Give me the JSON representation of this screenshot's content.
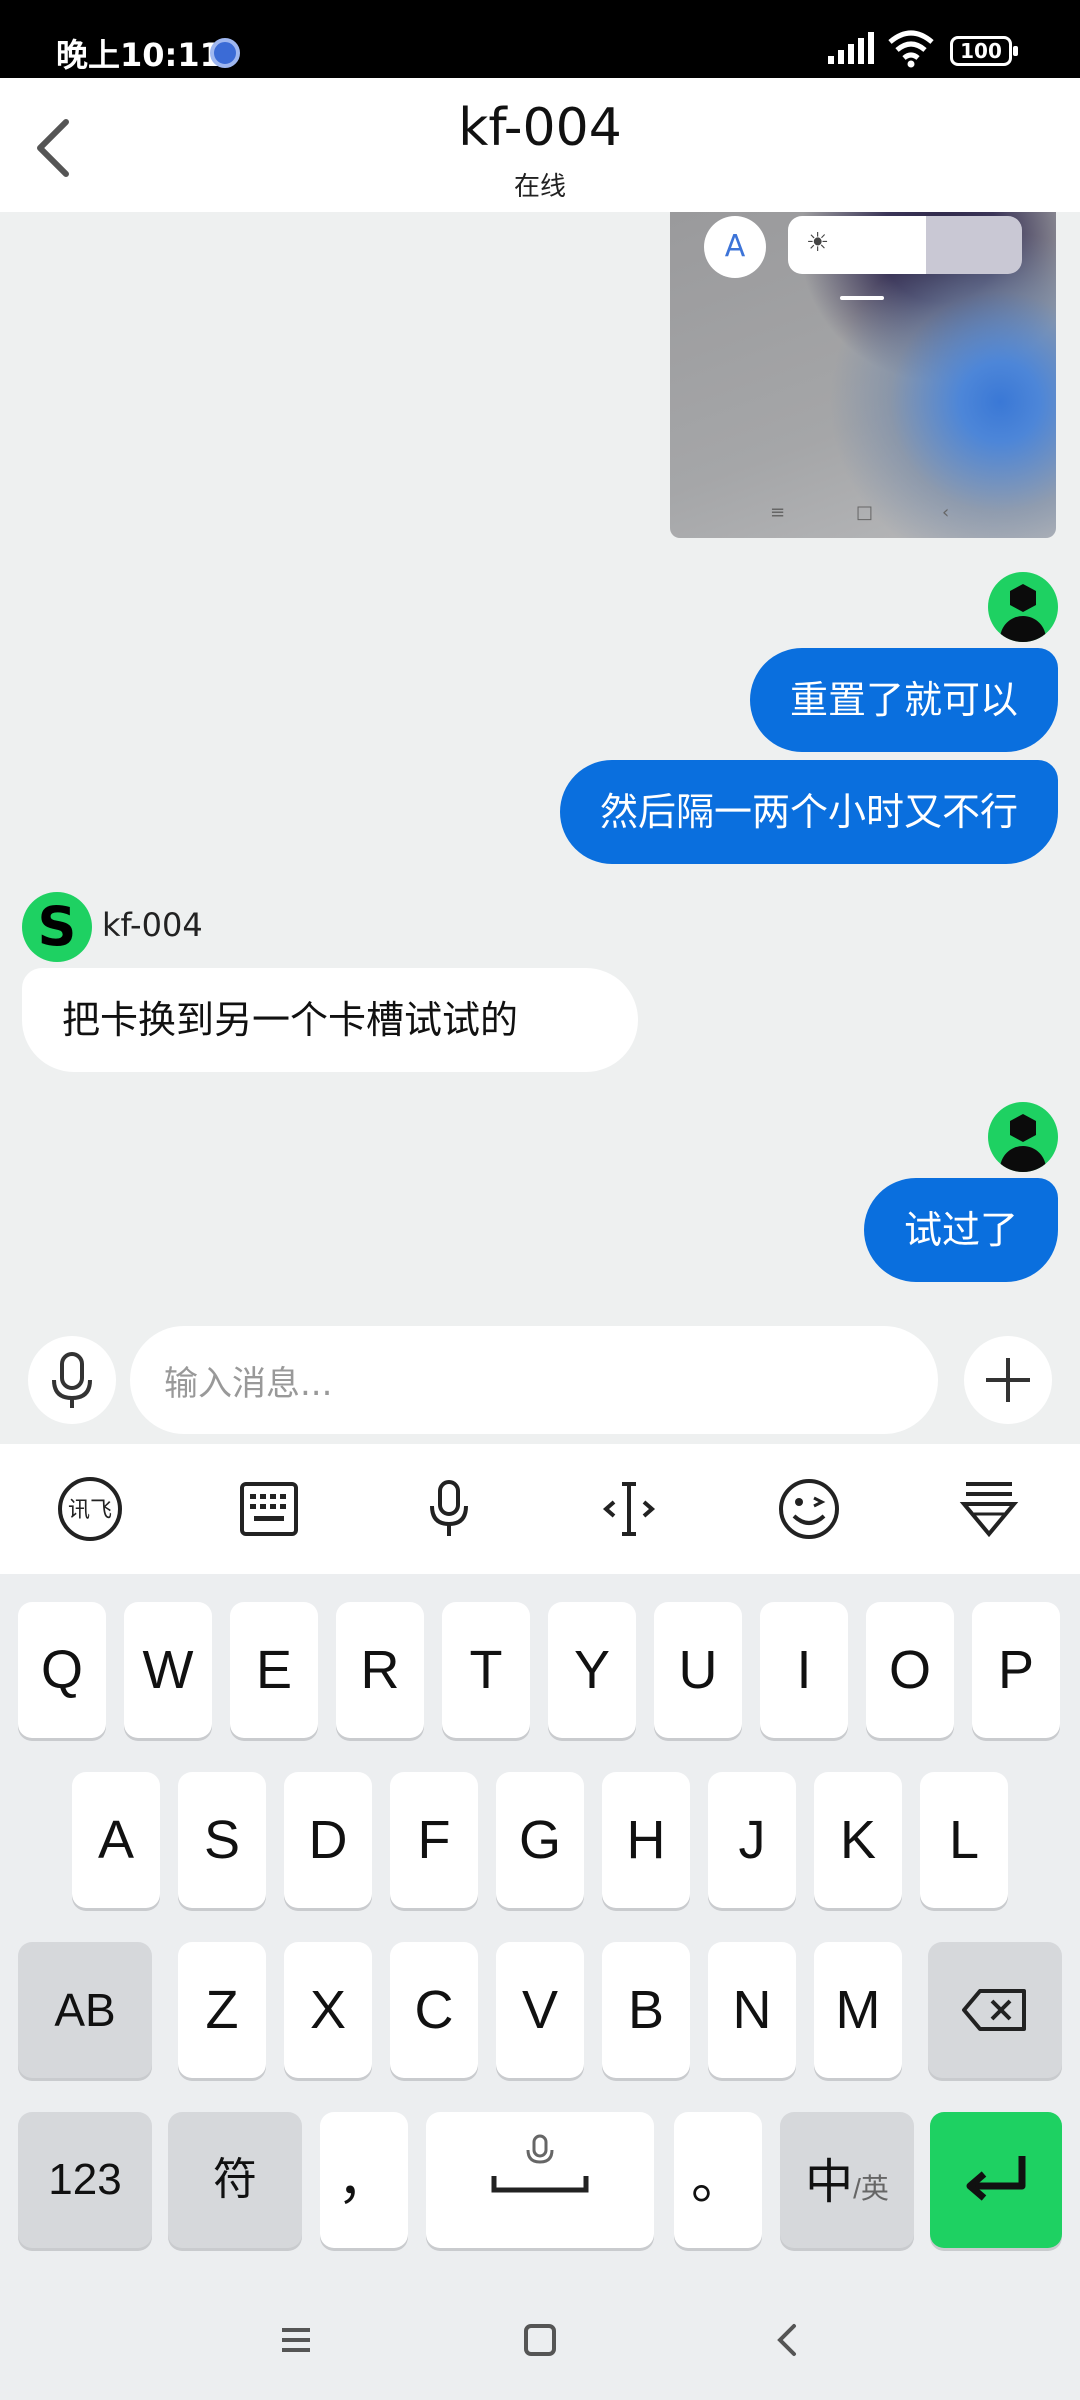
{
  "status_bar": {
    "time": "晚上10:11",
    "battery": "100"
  },
  "header": {
    "title": "kf-004",
    "subtitle": "在线"
  },
  "screenshot_preview": {
    "a_label": "A",
    "brightness_icon": "☀"
  },
  "messages": [
    {
      "from": "me",
      "text": "重置了就可以"
    },
    {
      "from": "me",
      "text": "然后隔一两个小时又不行"
    },
    {
      "from": "kf-004",
      "sender_name": "kf-004",
      "text": "把卡换到另一个卡槽试试的"
    },
    {
      "from": "me",
      "text": "试过了"
    }
  ],
  "input": {
    "placeholder": "输入消息..."
  },
  "ime_toolbar": [
    "xunfei-logo-icon",
    "keyboard-icon",
    "mic-icon",
    "cursor-icon",
    "emoji-icon",
    "collapse-icon"
  ],
  "keyboard": {
    "row1": [
      "Q",
      "W",
      "E",
      "R",
      "T",
      "Y",
      "U",
      "I",
      "O",
      "P"
    ],
    "row2": [
      "A",
      "S",
      "D",
      "F",
      "G",
      "H",
      "J",
      "K",
      "L"
    ],
    "row3": {
      "shift": "AB",
      "keys": [
        "Z",
        "X",
        "C",
        "V",
        "B",
        "N",
        "M"
      ]
    },
    "row4": {
      "num": "123",
      "sym": "符",
      "comma": "，",
      "period": "。",
      "lang_main": "中",
      "lang_alt": "/英"
    }
  },
  "colors": {
    "accent_blue": "#0a6fde",
    "accent_green": "#1ed162",
    "background": "#eef0f0"
  }
}
